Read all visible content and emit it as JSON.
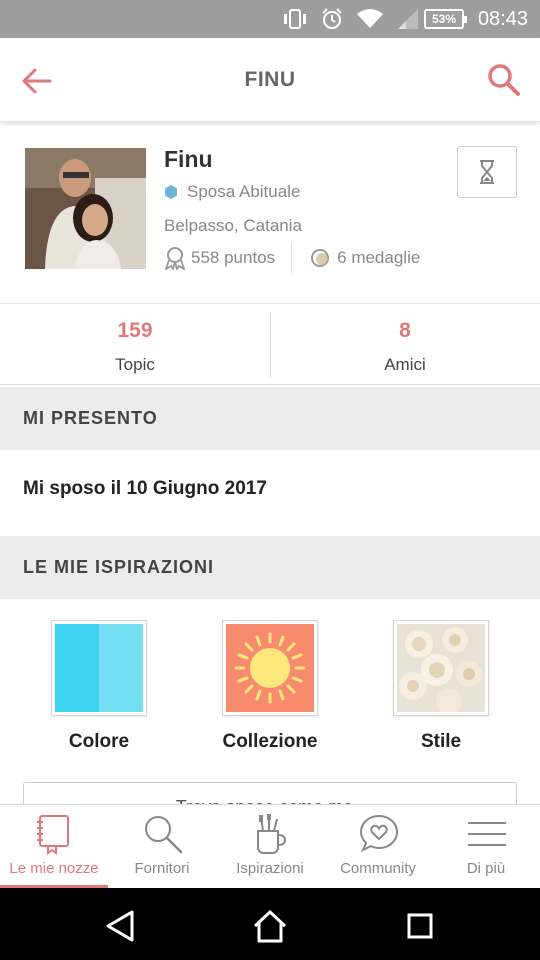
{
  "status_bar": {
    "battery": "53%",
    "time": "08:43"
  },
  "app_bar": {
    "title": "FINU"
  },
  "profile": {
    "name": "Finu",
    "role": "Sposa Abituale",
    "location": "Belpasso, Catania",
    "points": "558 puntos",
    "medals": "6 medaglie"
  },
  "counts": [
    {
      "value": "159",
      "label": "Topic"
    },
    {
      "value": "8",
      "label": "Amici"
    }
  ],
  "sections": {
    "presento_title": "MI PRESENTO",
    "presento_text": "Mi sposo il 10 Giugno 2017",
    "ispirazioni_title": "LE MIE ISPIRAZIONI"
  },
  "inspirations": [
    {
      "label": "Colore"
    },
    {
      "label": "Collezione"
    },
    {
      "label": "Stile"
    }
  ],
  "find_button": "Trova spose come me",
  "bottom_nav": [
    {
      "label": "Le mie nozze",
      "icon": "notebook-icon",
      "active": true
    },
    {
      "label": "Fornitori",
      "icon": "search-icon",
      "active": false
    },
    {
      "label": "Ispirazioni",
      "icon": "brush-cup-icon",
      "active": false
    },
    {
      "label": "Community",
      "icon": "heart-bubble-icon",
      "active": false
    },
    {
      "label": "Di più",
      "icon": "menu-icon",
      "active": false
    }
  ],
  "colors": {
    "accent": "#e0787a",
    "section_bg": "#ececec",
    "status_bar": "#9e9e9e",
    "swatch_blue_1": "#3fd3f2",
    "swatch_blue_2": "#74def3",
    "sun_bg": "#f88b6e",
    "sun": "#fde97b"
  }
}
